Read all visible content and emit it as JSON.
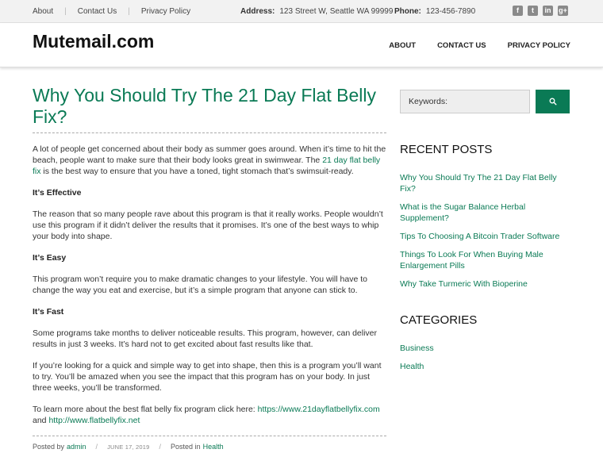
{
  "topbar": {
    "links": [
      "About",
      "Contact Us",
      "Privacy Policy"
    ],
    "address_label": "Address:",
    "address_value": "123 Street W, Seattle WA 99999",
    "phone_label": "Phone:",
    "phone_value": "123-456-7890",
    "social_icons": [
      "facebook-icon",
      "twitter-icon",
      "linkedin-icon",
      "google-plus-icon"
    ]
  },
  "header": {
    "logo": "Mutemail.com",
    "nav": [
      "ABOUT",
      "CONTACT US",
      "PRIVACY POLICY"
    ]
  },
  "post": {
    "title": "Why You Should Try The 21 Day Flat Belly Fix?",
    "intro_pre": "A lot of people get concerned about their body as summer goes around. When it’s time to hit the beach, people want to make sure that their body looks great in swimwear. The ",
    "intro_link": "21 day flat belly fix",
    "intro_post": " is the best way to ensure that you have a toned, tight stomach that’s swimsuit-ready.",
    "h1": "It’s Effective",
    "p1": "The reason that so many people rave about this program is that it really works. People wouldn’t use this program if it didn’t deliver the results that it promises. It’s one of the best ways to whip your body into shape.",
    "h2": "It’s Easy",
    "p2": "This program won’t require you to make dramatic changes to your lifestyle. You will have to change the way you eat and exercise, but it’s a simple program that anyone can stick to.",
    "h3": "It’s Fast",
    "p3": "Some programs take months to deliver noticeable results. This program, however, can deliver results in just 3 weeks. It’s hard not to get excited about fast results like that.",
    "p4": "If you’re looking for a quick and simple way to get into shape, then this is a program you’ll want to try. You’ll be amazed when you see the impact that this program has on your body. In just three weeks, you’ll be transformed.",
    "p5_pre": "To learn more about the best flat belly fix program click here: ",
    "p5_link1": "https://www.21dayflatbellyfix.com",
    "p5_mid": " and ",
    "p5_link2": "http://www.flatbellyfix.net",
    "meta_posted_by": "Posted by",
    "meta_author": "admin",
    "meta_date": "JUNE 17, 2019",
    "meta_posted_in": "Posted in",
    "meta_category": "Health"
  },
  "sidebar": {
    "search_placeholder": "Keywords:",
    "search_icon": "search-icon",
    "recent_title": "RECENT POSTS",
    "recent": [
      "Why You Should Try The 21 Day Flat Belly Fix?",
      "What is the Sugar Balance Herbal Supplement?",
      "Tips To Choosing A Bitcoin Trader Software",
      "Things To Look For When Buying Male Enlargement Pills",
      "Why Take Turmeric With Bioperine"
    ],
    "categories_title": "CATEGORIES",
    "categories": [
      "Business",
      "Health"
    ]
  },
  "colors": {
    "accent": "#0a7a55",
    "topbar_bg": "#f2f2f2"
  }
}
